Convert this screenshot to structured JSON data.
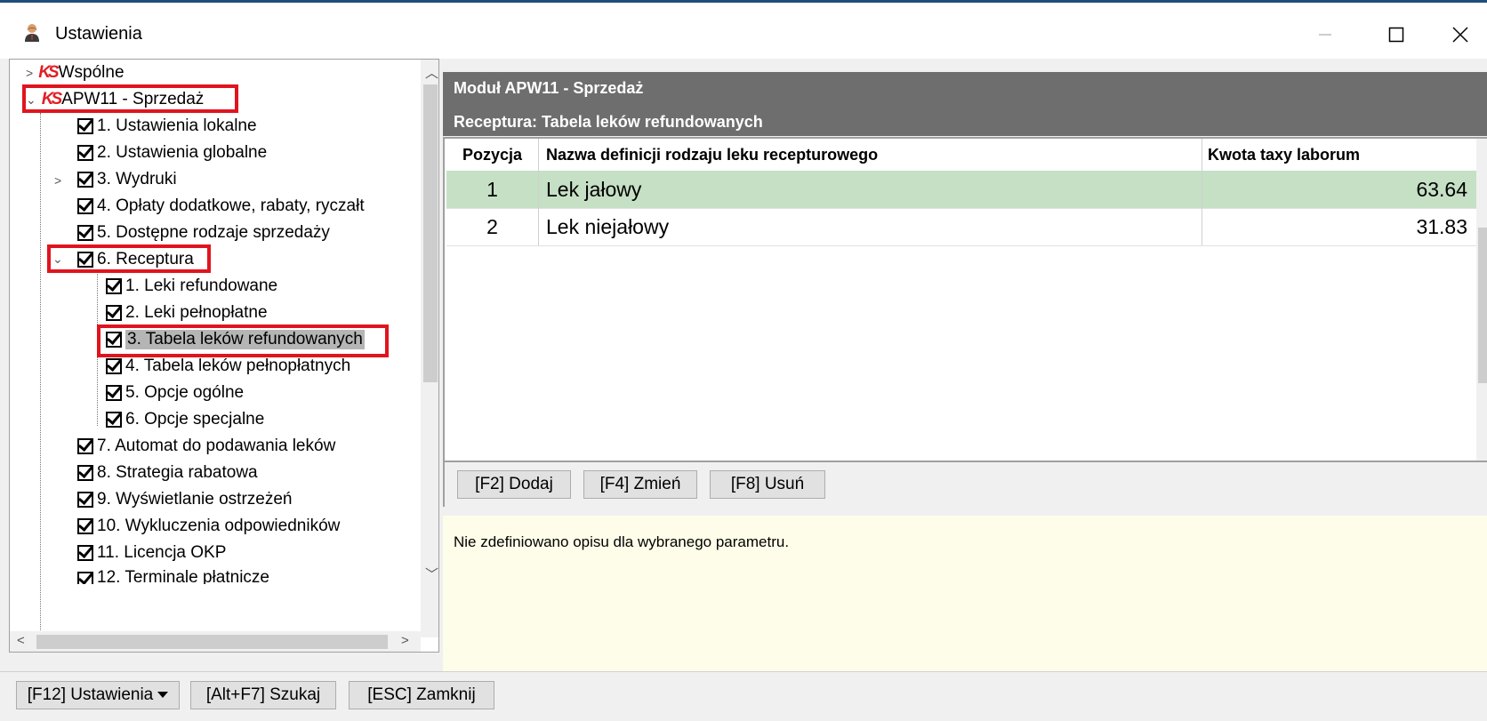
{
  "window": {
    "title": "Ustawienia"
  },
  "tree": {
    "root1": "Wspólne",
    "root2": "APW11 - Sprzedaż",
    "logo_text": "KS",
    "items": [
      "1. Ustawienia lokalne",
      "2. Ustawienia globalne",
      "3. Wydruki",
      "4. Opłaty dodatkowe, rabaty, ryczałt",
      "5. Dostępne rodzaje sprzedaży",
      "6. Receptura",
      "7. Automat do podawania leków",
      "8. Strategia rabatowa",
      "9. Wyświetlanie ostrzeżeń",
      "10. Wykluczenia odpowiedników",
      "11. Licencja OKP",
      "12. Terminale płatnicze"
    ],
    "receptura_children": [
      "1. Leki refundowane",
      "2. Leki pełnopłatne",
      "3. Tabela leków refundowanych",
      "4. Tabela leków pełnopłatnych",
      "5. Opcje ogólne",
      "6. Opcje specjalne"
    ],
    "selected": "3. Tabela leków refundowanych"
  },
  "header": {
    "module": "Moduł APW11 - Sprzedaż",
    "section": "Receptura: Tabela leków refundowanych"
  },
  "grid": {
    "columns": [
      "Pozycja",
      "Nazwa definicji rodzaju leku recepturowego",
      "Kwota taxy laborum"
    ],
    "rows": [
      {
        "pos": "1",
        "name": "Lek jałowy",
        "amount": "63.64"
      },
      {
        "pos": "2",
        "name": "Lek niejałowy",
        "amount": "31.83"
      }
    ]
  },
  "actions": {
    "add": "[F2] Dodaj",
    "edit": "[F4] Zmień",
    "delete": "[F8] Usuń"
  },
  "description": "Nie zdefiniowano opisu dla wybranego parametru.",
  "footer": {
    "settings": "[F12] Ustawienia",
    "search": "[Alt+F7] Szukaj",
    "close": "[ESC] Zamknij"
  },
  "colors": {
    "highlight_box": "#e0141e",
    "header_bg": "#6e6e6e",
    "active_row": "#c6e0c6",
    "desc_bg": "#fefde9"
  }
}
